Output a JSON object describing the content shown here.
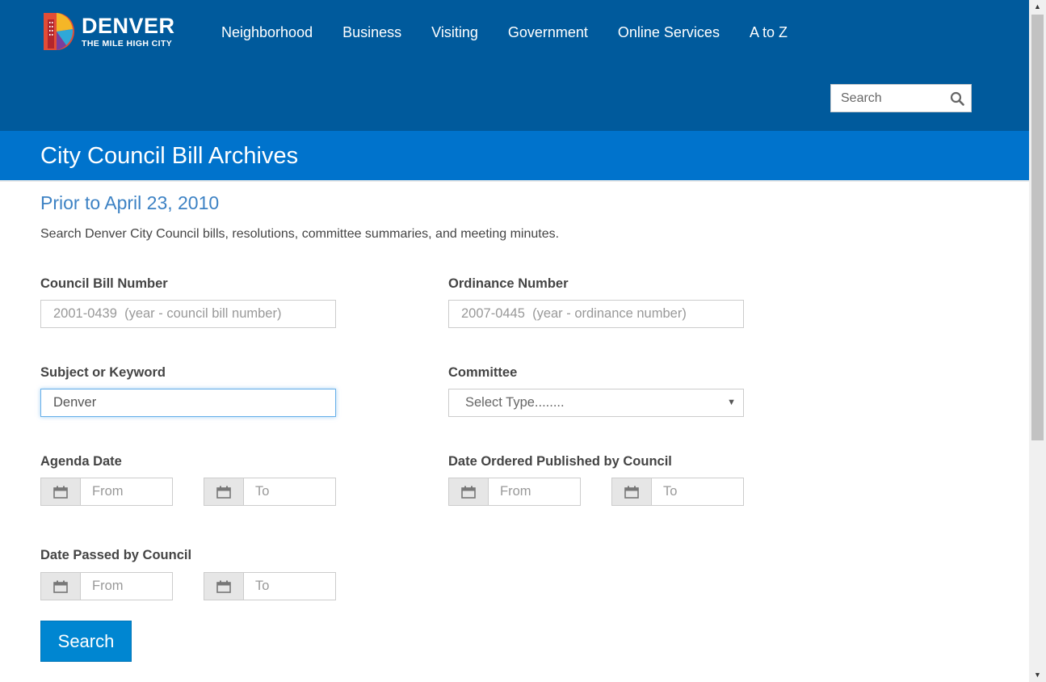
{
  "brand": {
    "name": "DENVER",
    "tagline": "THE MILE HIGH CITY"
  },
  "nav": [
    {
      "label": "Neighborhood"
    },
    {
      "label": "Business"
    },
    {
      "label": "Visiting"
    },
    {
      "label": "Government"
    },
    {
      "label": "Online Services"
    },
    {
      "label": "A to Z"
    }
  ],
  "top_search": {
    "placeholder": "Search"
  },
  "page": {
    "title": "City Council Bill Archives",
    "subtitle": "Prior to April 23, 2010",
    "intro": "Search Denver City Council bills, resolutions, committee summaries, and meeting minutes."
  },
  "form": {
    "council_bill": {
      "label": "Council Bill Number",
      "placeholder": "2001-0439  (year - council bill number)",
      "value": ""
    },
    "ordinance": {
      "label": "Ordinance Number",
      "placeholder": "2007-0445  (year - ordinance number)",
      "value": ""
    },
    "subject": {
      "label": "Subject or Keyword",
      "placeholder": "",
      "value": "Denver"
    },
    "committee": {
      "label": "Committee",
      "selected": "Select Type........"
    },
    "agenda_date": {
      "label": "Agenda Date",
      "from_placeholder": "From",
      "to_placeholder": "To"
    },
    "date_published": {
      "label": "Date Ordered Published by Council",
      "from_placeholder": "From",
      "to_placeholder": "To"
    },
    "date_passed": {
      "label": "Date Passed by Council",
      "from_placeholder": "From",
      "to_placeholder": "To"
    },
    "submit_label": "Search"
  },
  "colors": {
    "header_bg": "#005a9c",
    "title_bar_bg": "#0073cc",
    "subtitle": "#3d82c4",
    "button_bg": "#0086d1"
  }
}
